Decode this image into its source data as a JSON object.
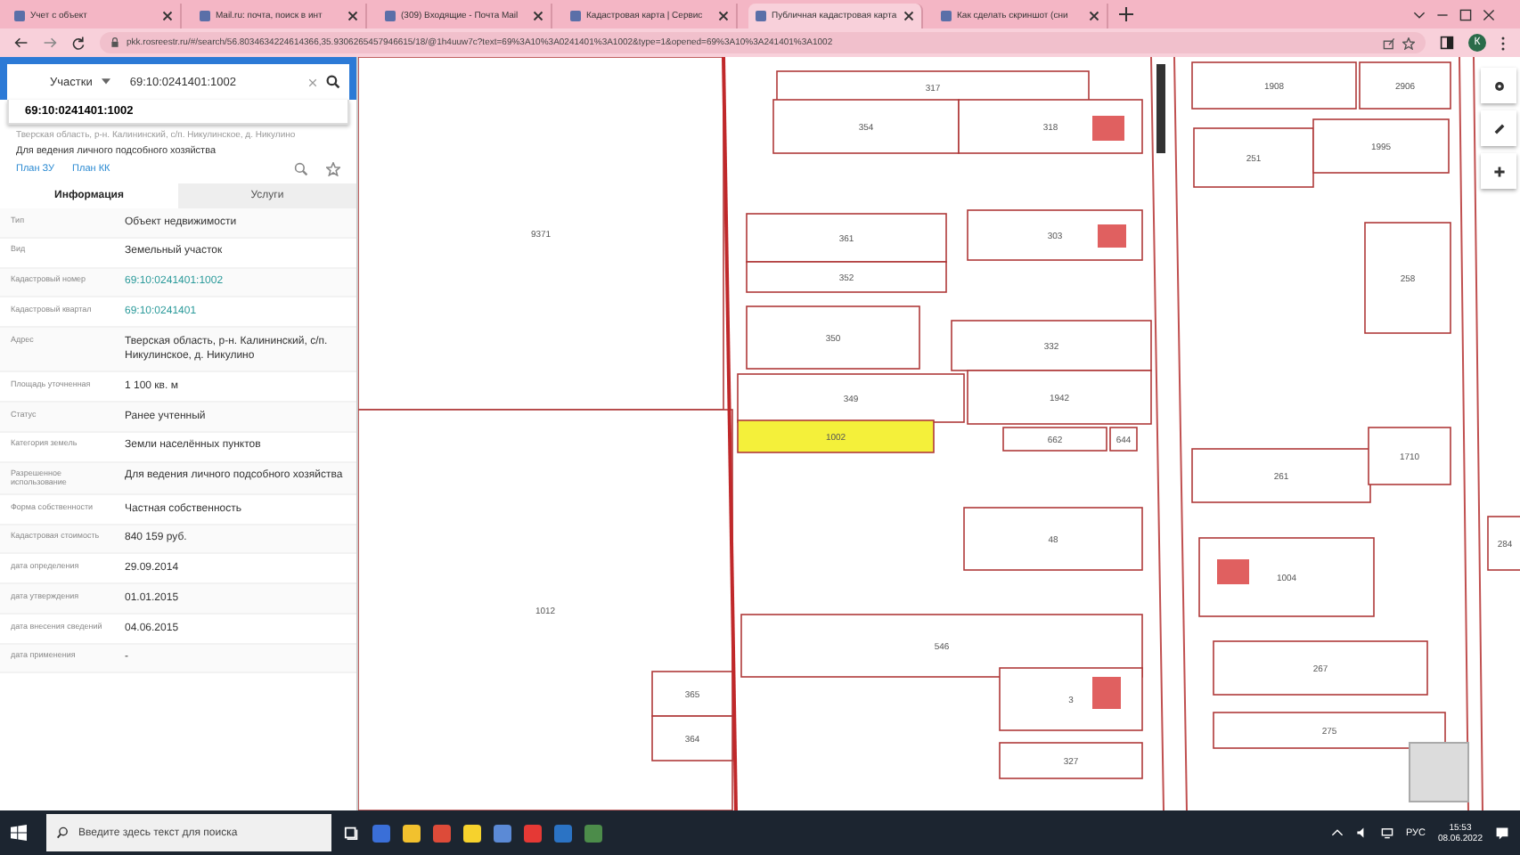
{
  "browser": {
    "tabs": [
      {
        "title": "Учет с объект",
        "selected": false
      },
      {
        "title": "Mail.ru: почта, поиск в инт",
        "selected": false
      },
      {
        "title": "(309) Входящие - Почта Mail",
        "selected": false
      },
      {
        "title": "Кадастровая карта | Сервис",
        "selected": false
      },
      {
        "title": "Публичная кадастровая карта",
        "selected": true
      },
      {
        "title": "Как сделать скриншот (сни",
        "selected": false
      }
    ],
    "url": "pkk.rosreestr.ru/#/search/56.8034634224614366,35.9306265457946615/18/@1h4uuw7c?text=69%3A10%3A0241401%3A1002&type=1&opened=69%3A10%3A241401%3A1002",
    "profile_initial": "К"
  },
  "sidebar": {
    "search": {
      "category": "Участки",
      "value": "69:10:0241401:1002"
    },
    "suggestion": "69:10:0241401:1002",
    "parcel_address": "Тверская область, р-н. Калининский, с/п. Никулинское, д. Никулино",
    "parcel_purpose": "Для ведения личного подсобного хозяйства",
    "links": [
      "План ЗУ",
      "План КК"
    ],
    "tabs": [
      {
        "label": "Информация",
        "selected": true
      },
      {
        "label": "Услуги",
        "selected": false
      }
    ],
    "rows": [
      {
        "label": "Тип",
        "value": "Объект недвижимости",
        "kind": "text"
      },
      {
        "label": "Вид",
        "value": "Земельный участок",
        "kind": "text"
      },
      {
        "label": "Кадастровый номер",
        "value": "69:10:0241401:1002",
        "kind": "link"
      },
      {
        "label": "Кадастровый квартал",
        "value": "69:10:0241401",
        "kind": "link"
      },
      {
        "label": "Адрес",
        "value": "Тверская область, р-н. Калининский, с/п. Никулинское, д. Никулино",
        "kind": "text"
      },
      {
        "label": "Площадь уточненная",
        "value": "1 100 кв. м",
        "kind": "text"
      },
      {
        "label": "Статус",
        "value": "Ранее учтенный",
        "kind": "text"
      },
      {
        "label": "Категория земель",
        "value": "Земли населённых пунктов",
        "kind": "text"
      },
      {
        "label": "Разрешенное использование",
        "value": "Для ведения личного подсобного хозяйства",
        "kind": "text"
      },
      {
        "label": "Форма собственности",
        "value": "Частная собственность",
        "kind": "text"
      },
      {
        "label": "Кадастровая стоимость",
        "value": "840 159 руб.",
        "kind": "text"
      },
      {
        "label": "дата определения",
        "value": "29.09.2014",
        "kind": "text"
      },
      {
        "label": "дата утверждения",
        "value": "01.01.2015",
        "kind": "text"
      },
      {
        "label": "дата внесения сведений",
        "value": "04.06.2015",
        "kind": "text"
      },
      {
        "label": "дата применения",
        "value": "-",
        "kind": "text"
      }
    ]
  },
  "map": {
    "parcels": [
      {
        "label": "9371",
        "selected": false
      },
      {
        "label": "1012",
        "selected": false
      },
      {
        "label": "317",
        "selected": false
      },
      {
        "label": "354",
        "selected": false
      },
      {
        "label": "318",
        "selected": false
      },
      {
        "label": "361",
        "selected": false
      },
      {
        "label": "352",
        "selected": false
      },
      {
        "label": "303",
        "selected": false
      },
      {
        "label": "350",
        "selected": false
      },
      {
        "label": "332",
        "selected": false
      },
      {
        "label": "349",
        "selected": false
      },
      {
        "label": "1942",
        "selected": false
      },
      {
        "label": "1002",
        "selected": true
      },
      {
        "label": "662",
        "selected": false
      },
      {
        "label": "644",
        "selected": false
      },
      {
        "label": "1908",
        "selected": false
      },
      {
        "label": "2906",
        "selected": false
      },
      {
        "label": "251",
        "selected": false
      },
      {
        "label": "1995",
        "selected": false
      },
      {
        "label": "258",
        "selected": false
      },
      {
        "label": "261",
        "selected": false
      },
      {
        "label": "1710",
        "selected": false
      },
      {
        "label": "48",
        "selected": false
      },
      {
        "label": "546",
        "selected": false
      },
      {
        "label": "3",
        "selected": false
      },
      {
        "label": "1004",
        "selected": false
      },
      {
        "label": "267",
        "selected": false
      },
      {
        "label": "275",
        "selected": false
      },
      {
        "label": "284",
        "selected": false
      },
      {
        "label": "365",
        "selected": false
      },
      {
        "label": "364",
        "selected": false
      },
      {
        "label": "327",
        "selected": false
      }
    ]
  },
  "taskbar": {
    "search_placeholder": "Введите здесь текст для поиска",
    "language": "РУС",
    "time": "15:53",
    "date": "08.06.2022"
  }
}
